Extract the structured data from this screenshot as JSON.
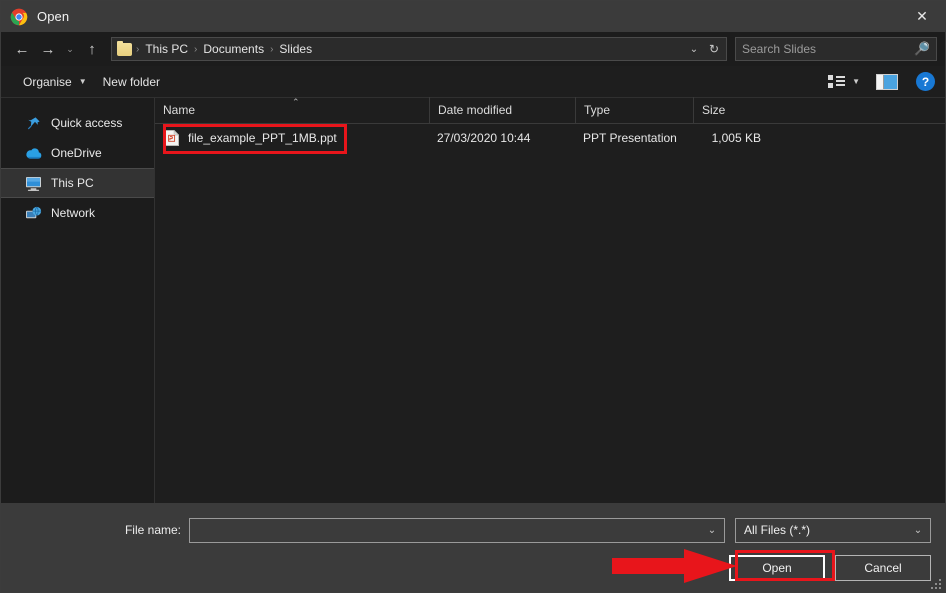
{
  "window": {
    "title": "Open",
    "app_icon": "chrome-icon",
    "close_label": "✕"
  },
  "addressbar": {
    "back_icon": "←",
    "forward_icon": "→",
    "history_icon": "⌄",
    "up_icon": "↑",
    "breadcrumbs": [
      "This PC",
      "Documents",
      "Slides"
    ],
    "separator": "›",
    "dropdown_icon": "⌄",
    "refresh_icon": "↻",
    "search_placeholder": "Search Slides",
    "search_value": "",
    "search_icon": "search-icon"
  },
  "toolbar": {
    "organise_label": "Organise",
    "organise_caret": "▼",
    "new_folder_label": "New folder",
    "view_icon": "view-list-icon",
    "view_caret": "▼",
    "preview_pane_icon": "preview-pane-icon",
    "help_label": "?"
  },
  "sidebar": {
    "items": [
      {
        "label": "Quick access",
        "icon": "star-pin-icon",
        "selected": false
      },
      {
        "label": "OneDrive",
        "icon": "cloud-icon",
        "selected": false
      },
      {
        "label": "This PC",
        "icon": "monitor-icon",
        "selected": true
      },
      {
        "label": "Network",
        "icon": "network-globe-icon",
        "selected": false
      }
    ]
  },
  "filelist": {
    "columns": [
      "Name",
      "Date modified",
      "Type",
      "Size"
    ],
    "sort_column": "Name",
    "sort_caret": "⌃",
    "rows": [
      {
        "name": "file_example_PPT_1MB.ppt",
        "date_modified": "27/03/2020 10:44",
        "type": "PPT Presentation",
        "size": "1,005 KB",
        "icon": "powerpoint-file-icon"
      }
    ]
  },
  "footer": {
    "filename_label": "File name:",
    "filename_value": "",
    "filename_placeholder": "",
    "filename_chevron": "⌄",
    "filter_value": "All Files (*.*)",
    "filter_chevron": "⌄",
    "open_label": "Open",
    "cancel_label": "Cancel"
  },
  "annotations": {
    "highlight_color": "#e8151b",
    "arrow_color": "#e8151b",
    "boxed_items": [
      "file_example_PPT_1MB.ppt",
      "Open"
    ],
    "arrow_points_to": "Open"
  }
}
